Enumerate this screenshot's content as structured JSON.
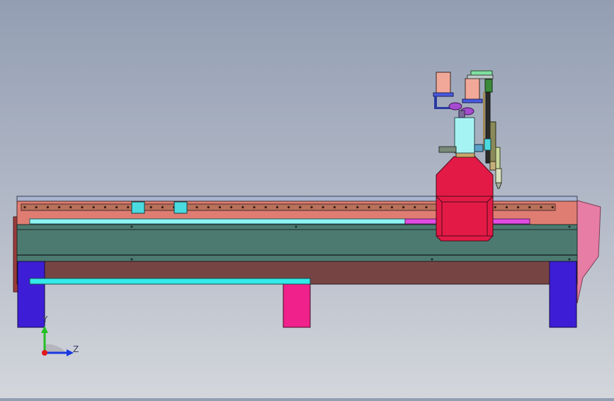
{
  "triad": {
    "y_label": "Y",
    "z_label": "Z"
  },
  "colors": {
    "background_top": "#939eb3",
    "background_bottom": "#d3d6db",
    "rail_salmon": "#e07d72",
    "beam_teal": "#4c7a70",
    "base_brown": "#774444",
    "leg_purple": "#3d1ed6",
    "leg_pink": "#f0218a",
    "cyan_bar": "#33eaea",
    "gantry_red": "#e41a46",
    "end_plate_pink": "#e77da4",
    "magenta_strip": "#e34be3"
  },
  "icons": {
    "triad": "coordinate-axes-icon"
  }
}
